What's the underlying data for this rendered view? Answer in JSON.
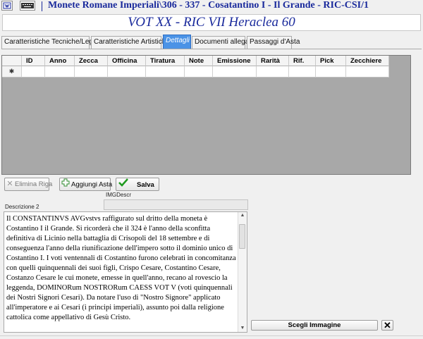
{
  "window": {
    "title": "Monete Romane Imperiali\\306 - 337 - Cosatantino I - Il Grande - RIC-CSI/1"
  },
  "subtitle": "VOT XX - RIC VII Heraclea 60",
  "tabs": [
    {
      "label": "Caratteristiche Tecniche/Legali",
      "active": false
    },
    {
      "label": "Caratteristiche Artistiche",
      "active": false
    },
    {
      "label": "Dettagli",
      "active": true
    },
    {
      "label": "Documenti allegati",
      "active": false
    },
    {
      "label": "Passaggi d'Asta",
      "active": false
    }
  ],
  "grid": {
    "columns": [
      "ID",
      "Anno",
      "Zecca",
      "Officina",
      "Tiratura",
      "Note",
      "Emissione",
      "Rarità",
      "Rif.",
      "Pick",
      "Zecchiere"
    ],
    "new_row_marker": "✱"
  },
  "buttons": {
    "elimina": "Elimina Riga",
    "aggiungi": "Aggiungi Asta",
    "salva": "Salva",
    "scegli": "Scegli Immagine",
    "close": "✕"
  },
  "labels": {
    "imgdescr": "IMGDescr",
    "descrizione": "Descrizione 2"
  },
  "description": "Il CONSTANTINVS AVGvstvs raffigurato sul dritto della moneta è Costantino I il Grande. Si ricorderà che il 324 è l'anno della sconfitta definitiva di Licinio nella battaglia di Crisopoli del 18 settembre e di conseguenza l'anno della riunificazione dell'impero sotto il dominio unico di Costantino I. I voti ventennali di Costantino furono celebrati in concomitanza con quelli quinquennali dei suoi figli, Crispo Cesare, Costantino Cesare, Costanzo Cesare le cui monete, emesse in quell'anno, recano al rovescio la leggenda, DOMINORum NOSTRORum CAESS VOT V (voti quinquennali dei Nostri Signori Cesari). Da notare l'uso di \"Nostro Signore\" applicato all'imperatore e ai Cesari (i principi imperiali), assunto poi dalla religione cattolica come appellativo di Gesù Cristo.",
  "colors": {
    "title": "#1a2a9c",
    "active_tab": "#4b93e6",
    "grid_bg": "#a8a8a8"
  }
}
